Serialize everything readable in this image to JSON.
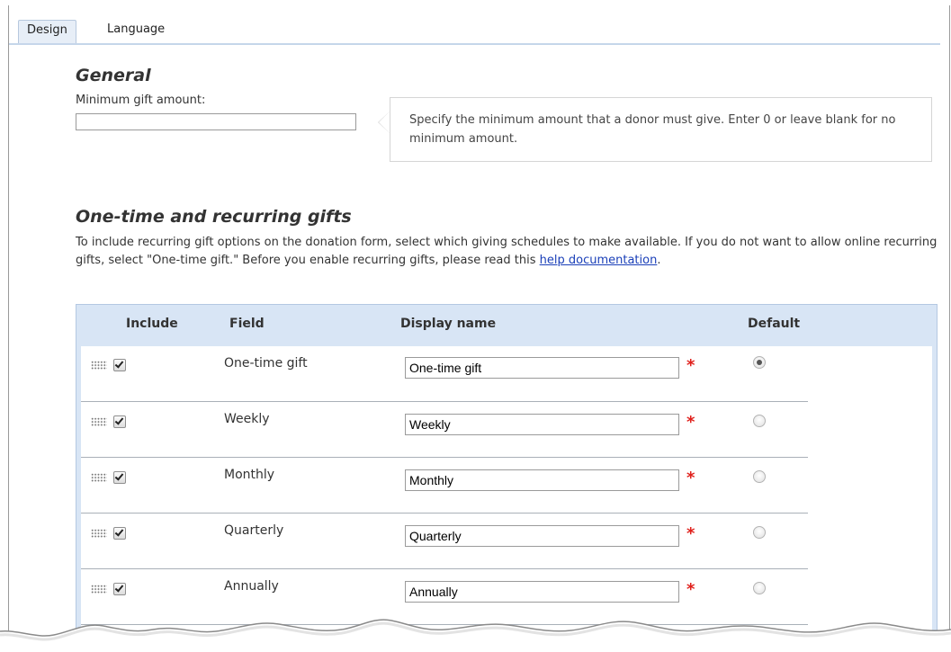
{
  "tabs": [
    {
      "label": "Design",
      "active": true
    },
    {
      "label": "Language",
      "active": false
    }
  ],
  "general": {
    "heading": "General",
    "min_gift_label": "Minimum gift amount:",
    "min_gift_value": "",
    "help_text": "Specify the minimum amount that a donor must give. Enter 0 or leave blank for no minimum amount."
  },
  "gifts": {
    "heading": "One-time and recurring gifts",
    "intro_text": "To include recurring gift options on the donation form, select which giving schedules to make available. If you do not want to allow online recurring gifts, select \"One-time gift.\" Before you enable recurring gifts, please read this ",
    "intro_link": "help documentation",
    "intro_end": ".",
    "columns": {
      "include": "Include",
      "field": "Field",
      "display_name": "Display name",
      "default": "Default"
    },
    "required_marker": "*",
    "rows": [
      {
        "field": "One-time gift",
        "display_name": "One-time gift",
        "include": true,
        "default": true
      },
      {
        "field": "Weekly",
        "display_name": "Weekly",
        "include": true,
        "default": false
      },
      {
        "field": "Monthly",
        "display_name": "Monthly",
        "include": true,
        "default": false
      },
      {
        "field": "Quarterly",
        "display_name": "Quarterly",
        "include": true,
        "default": false
      },
      {
        "field": "Annually",
        "display_name": "Annually",
        "include": true,
        "default": false
      }
    ]
  },
  "colors": {
    "header_bg": "#d8e5f5",
    "required": "#e0201b",
    "link": "#1a3fb8"
  }
}
